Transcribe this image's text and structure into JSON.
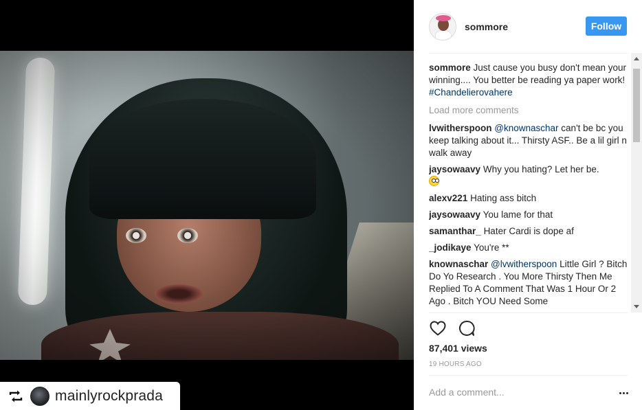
{
  "media": {
    "repost_user": "mainlyrockprada"
  },
  "post": {
    "author": "sommore",
    "follow_label": "Follow",
    "caption": {
      "username": "sommore",
      "text": "Just cause you busy don't mean your winning.... You better be reading ya paper work!",
      "hashtag": "#Chandelierovahere"
    },
    "load_more": "Load more comments",
    "comments": [
      {
        "username": "lvwitherspoon",
        "mention": "@knownaschar",
        "text": "can't be bc you keep talking about it... Thirsty ASF.. Be a lil girl n walk away"
      },
      {
        "username": "jaysowaavy",
        "mention": "",
        "text": "Why you hating? Let her be.",
        "emoji": "flushed-face"
      },
      {
        "username": "alexv221",
        "mention": "",
        "text": "Hating ass bitch"
      },
      {
        "username": "jaysowaavy",
        "mention": "",
        "text": "You lame for that"
      },
      {
        "username": "samanthar_",
        "mention": "",
        "text": "Hater Cardi is dope af"
      },
      {
        "username": "_jodikaye",
        "mention": "",
        "text": "You're **"
      },
      {
        "username": "knownaschar",
        "mention": "@lvwitherspoon",
        "text": "Little Girl ? Bitch Do Yo Research . You More Thirsty Then Me Replied To A Comment That Was 1 Hour Or 2 Ago . Bitch YOU Need Some"
      }
    ],
    "views": "87,401 views",
    "timestamp": "19 HOURS AGO",
    "add_comment_placeholder": "Add a comment..."
  },
  "colors": {
    "follow_button": "#3897f0",
    "link": "#003569",
    "muted": "#999999"
  }
}
